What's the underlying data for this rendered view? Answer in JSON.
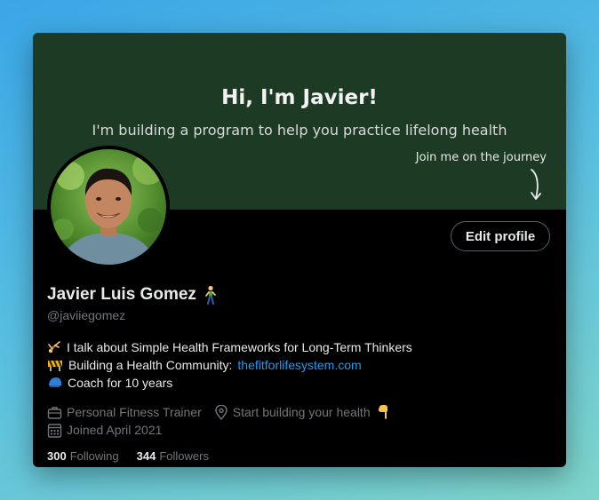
{
  "banner": {
    "title": "Hi, I'm Javier!",
    "subtitle": "I'm building a program to help you practice lifelong health",
    "cta": "Join me on the journey"
  },
  "profile": {
    "edit_button": "Edit profile",
    "name": "Javier Luis Gomez",
    "handle": "@javiiegomez",
    "bio": {
      "line1": "I talk about Simple Health Frameworks for Long-Term Thinkers",
      "line2_text": "Building a Health Community:",
      "line2_link": "thefitforlifesystem.com",
      "line3": "Coach for 10 years"
    },
    "meta": {
      "profession": "Personal Fitness Trainer",
      "location": "Start building your health",
      "joined": "Joined April 2021"
    },
    "stats": {
      "following_count": "300",
      "following_label": "Following",
      "followers_count": "344",
      "followers_label": "Followers"
    }
  },
  "colors": {
    "banner_bg": "#1d3b24",
    "link": "#1d9bf0",
    "muted": "#71767b",
    "text": "#e7e9ea"
  }
}
